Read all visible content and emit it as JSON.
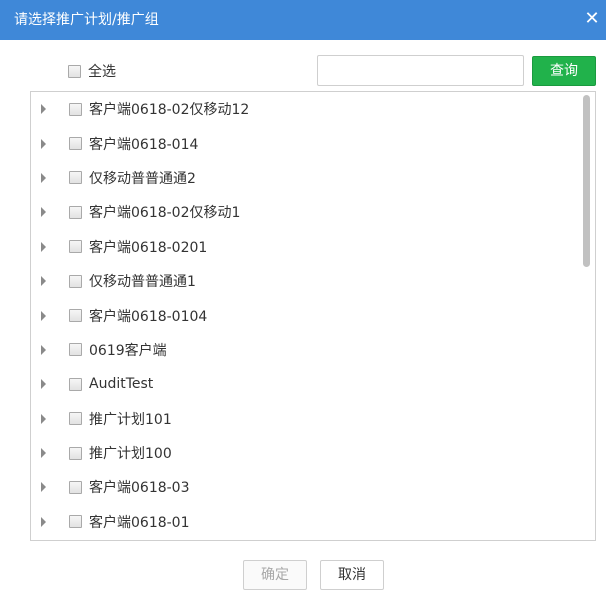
{
  "dialog": {
    "title": "请选择推广计划/推广组",
    "close_glyph": "✕"
  },
  "select_all": {
    "label": "全选"
  },
  "search": {
    "value": "",
    "placeholder": "",
    "button_label": "查询"
  },
  "tree": {
    "items": [
      {
        "label": "客户端0618-02仅移动12"
      },
      {
        "label": "客户端0618-014"
      },
      {
        "label": "仅移动普普通通2"
      },
      {
        "label": "客户端0618-02仅移动1"
      },
      {
        "label": "客户端0618-0201"
      },
      {
        "label": "仅移动普普通通1"
      },
      {
        "label": "客户端0618-0104"
      },
      {
        "label": "0619客户端"
      },
      {
        "label": "AuditTest"
      },
      {
        "label": "推广计划101"
      },
      {
        "label": "推广计划100"
      },
      {
        "label": "客户端0618-03"
      },
      {
        "label": "客户端0618-01"
      }
    ]
  },
  "footer": {
    "ok_label": "确定",
    "cancel_label": "取消"
  },
  "colors": {
    "titlebar": "#3f88d8",
    "query_button": "#21b24b"
  }
}
